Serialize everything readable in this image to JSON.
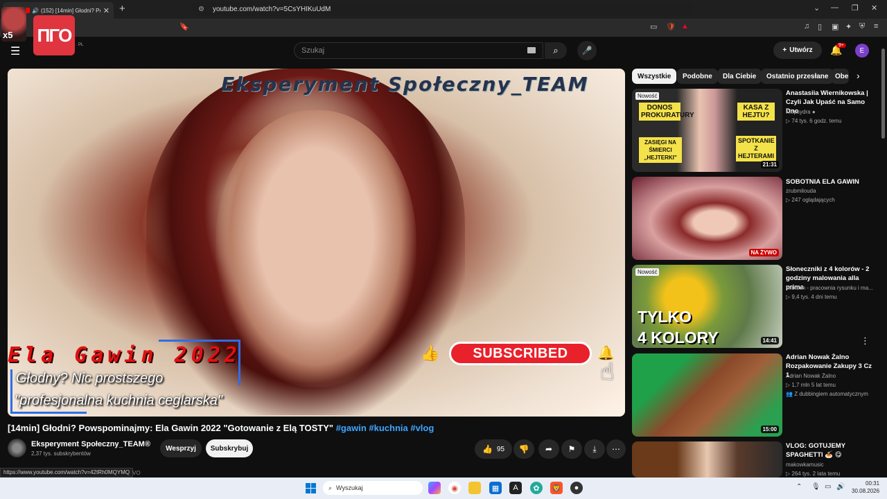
{
  "browser": {
    "tab_title": "(152) [14min] Głodni? Powsp",
    "url": "youtube.com/watch?v=5CsYHIKuUdM",
    "status_url": "https://www.youtube.com/watch?v=42tRh0MQYMQ",
    "status_tail": "VO"
  },
  "overlay": {
    "x5_label": "x5",
    "logo_text": "ΠΓO"
  },
  "header": {
    "country_code": "PL",
    "search_placeholder": "Szukaj",
    "create_label": "Utwórz",
    "notif_count": "9+",
    "avatar_letter": "E"
  },
  "video": {
    "overlay_top": "Eksperyment Społeczny_TEAM",
    "overlay_name": "Ela Gawin 2022",
    "overlay_line1": "Głodny? Nic prostszego",
    "overlay_line2": "\"profesjonalna kuchnia ceglarska\"",
    "overlay_sub_button": "SUBSCRIBED",
    "title_main": "[14min] Głodni? Powspominajmy: Ela Gawin 2022 \"Gotowanie z Elą TOSTY\"",
    "tags": "#gawin #kuchnia #vlog",
    "channel_name": "Eksperyment Społeczny_TEAM®",
    "channel_subs": "2,37 tys. subskrybentów",
    "support_label": "Wesprzyj",
    "subscribe_label": "Subskrybuj",
    "like_count": "95"
  },
  "chips": [
    "Wszystkie",
    "Podobne",
    "Dla Ciebie",
    "Ostatnio przesłane",
    "Obe"
  ],
  "related": [
    {
      "title": "Anastasiia Wiernikowska | Czyli Jak Upaść na Samo Dno",
      "channel": "Klepsydra",
      "meta": "74 tys.   6 godz. temu",
      "badge": "Nowość",
      "duration": "21:31",
      "thumb_texts": [
        "DONOS PROKURATURY",
        "KASA Z HEJTU?",
        "ZASIĘGI NA ŚMIERCI „HEJTERKI\"",
        "SPOTKANIE Z HEJTERAMI"
      ]
    },
    {
      "title": "SOBOTNIA ELA GAWIN",
      "channel": "zrubmilouda",
      "meta": "247 oglądających",
      "live": "NA ŻYWO"
    },
    {
      "title": "Słoneczniki z 4 kolorów - 2 godziny malowania alla prima",
      "channel": "sebtuch - pracownia rysunku i ma...",
      "meta": "9,4 tys.   4 dni temu",
      "badge": "Nowość",
      "duration": "14:41",
      "thumb_line1": "TYLKO",
      "thumb_line2": "4 KOLORY"
    },
    {
      "title": "Adrian Nowak Żalno Rozpakowanie Zakupy 3 Cz 1",
      "channel": "Adrian Nowak Żalno",
      "meta": "1,7 mln   5 lat temu",
      "extra": "Z dubbingiem automatycznym",
      "duration": "15:00"
    },
    {
      "title": "VLOG: GOTUJEMY SPAGHETTI 🍝 😋",
      "channel": "makowkamusic",
      "meta": "264 tys.   2 lata temu"
    }
  ],
  "taskbar": {
    "search_label": "Wyszukaj",
    "time": "00:31",
    "date": "30.08.2026"
  }
}
